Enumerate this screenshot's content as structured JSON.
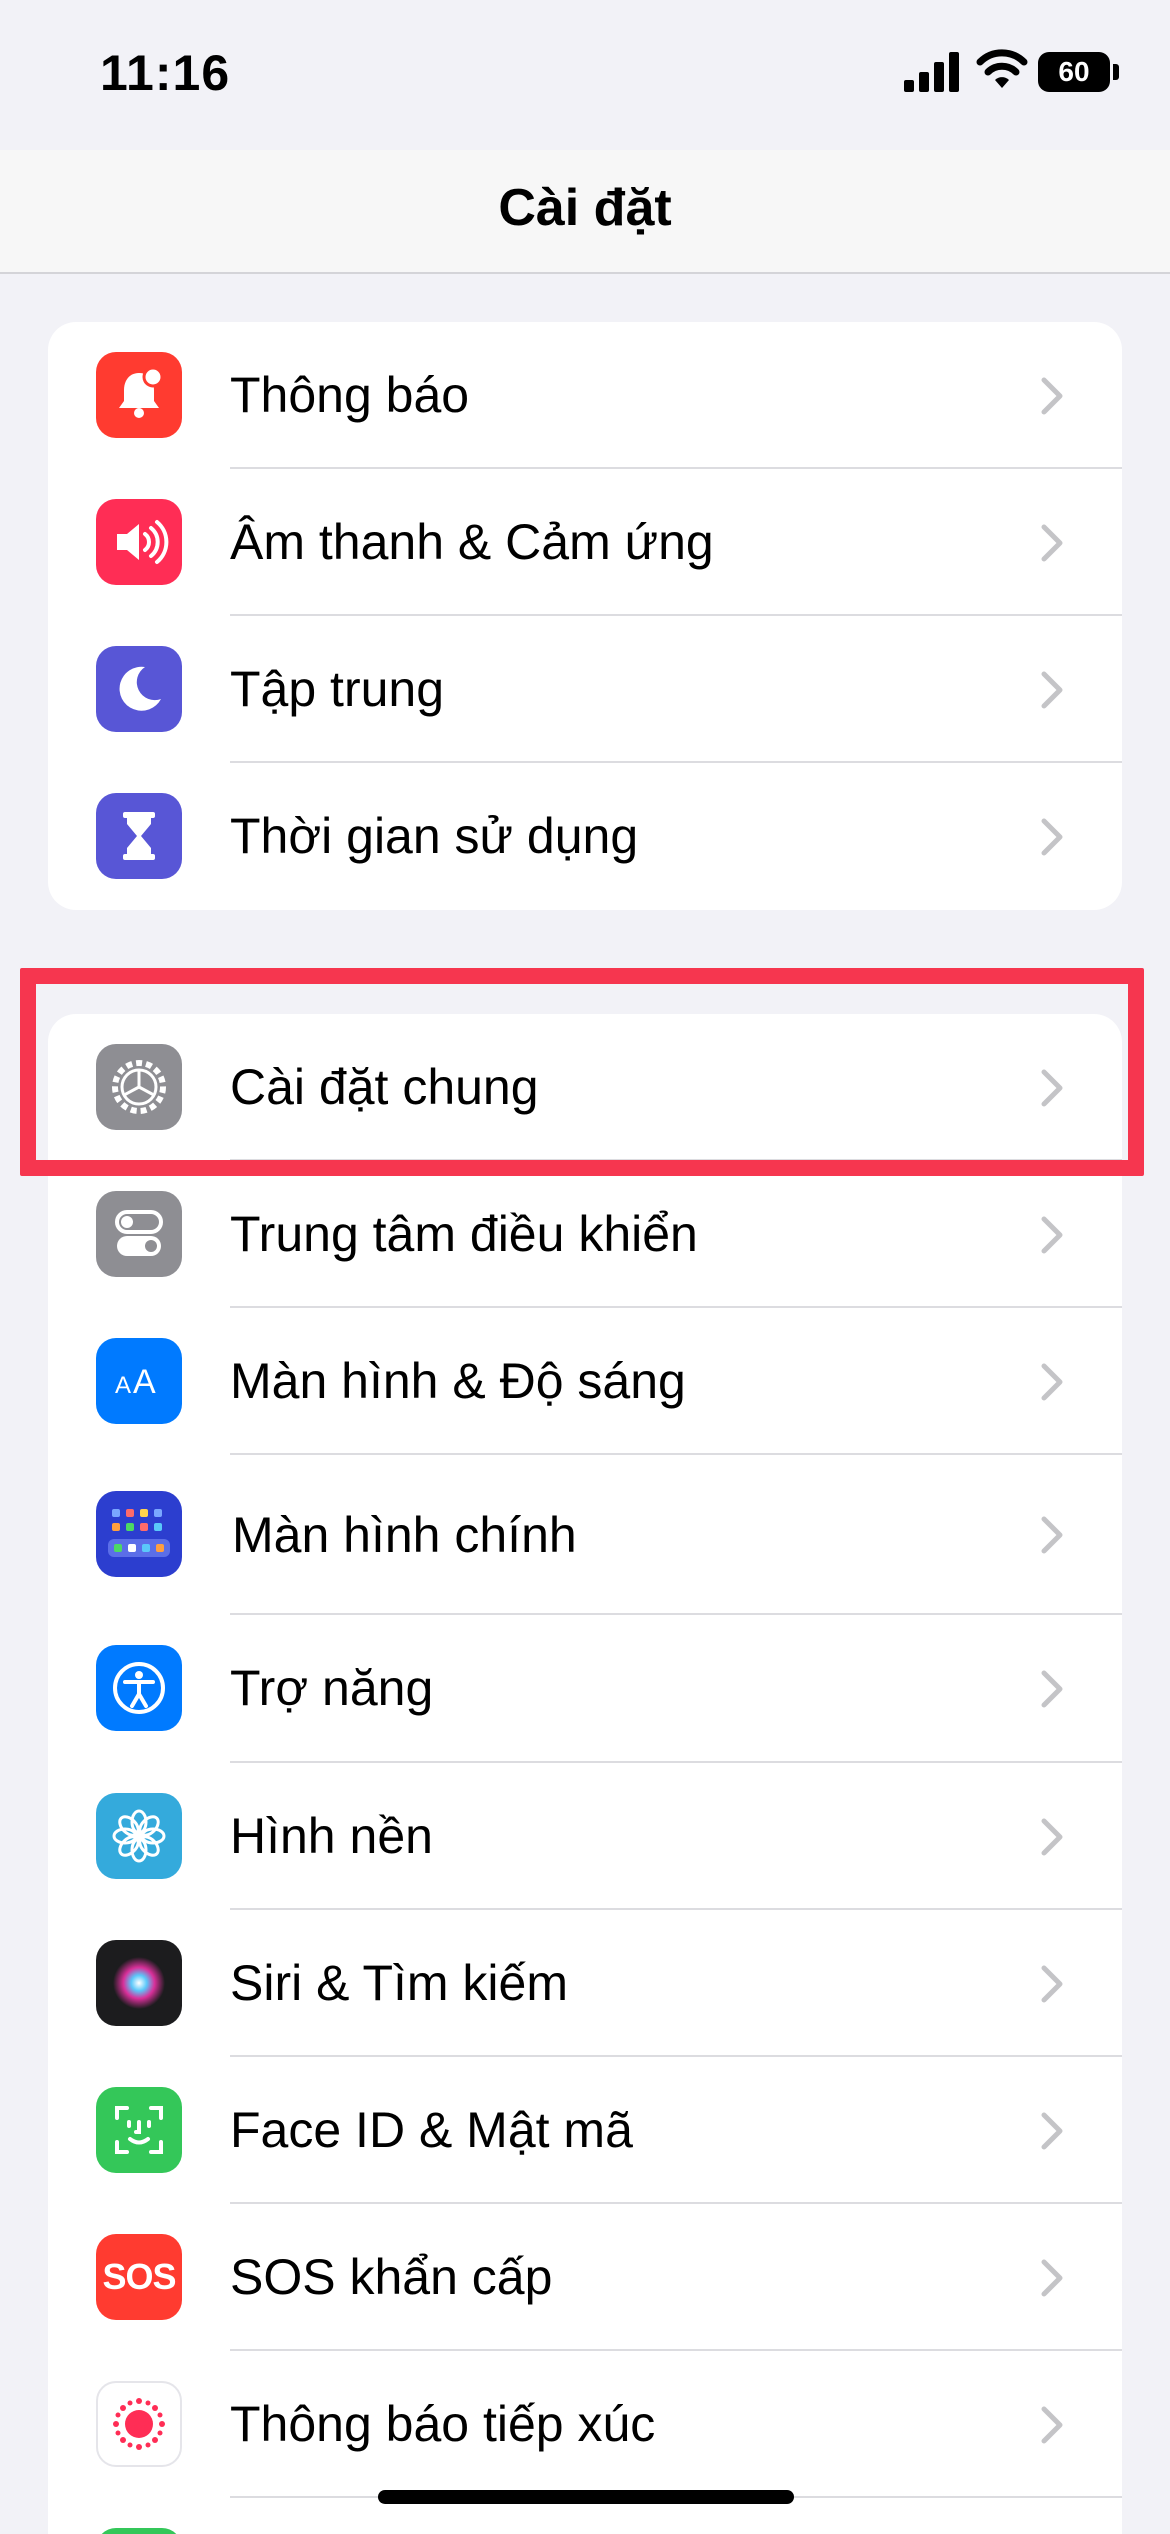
{
  "status": {
    "time": "11:16",
    "battery": "60"
  },
  "nav": {
    "title": "Cài đặt"
  },
  "groups": [
    {
      "items": [
        {
          "label": "Thông báo",
          "icon": "notifications-icon",
          "color": "#ff3b30"
        },
        {
          "label": "Âm thanh & Cảm ứng",
          "icon": "sounds-icon",
          "color": "#ff2d55"
        },
        {
          "label": "Tập trung",
          "icon": "focus-moon-icon",
          "color": "#5856d6"
        },
        {
          "label": "Thời gian sử dụng",
          "icon": "hourglass-icon",
          "color": "#5856d6"
        }
      ]
    },
    {
      "items": [
        {
          "label": "Cài đặt chung",
          "icon": "gear-icon",
          "color": "#8e8e93"
        },
        {
          "label": "Trung tâm điều khiển",
          "icon": "control-center-icon",
          "color": "#8e8e93"
        },
        {
          "label": "Màn hình & Độ sáng",
          "icon": "display-brightness-icon",
          "color": "#007aff"
        },
        {
          "label": "Màn hình chính",
          "icon": "home-screen-icon",
          "color": "#2c3ecf"
        },
        {
          "label": "Trợ năng",
          "icon": "accessibility-icon",
          "color": "#007aff"
        },
        {
          "label": "Hình nền",
          "icon": "wallpaper-flower-icon",
          "color": "#34aadc"
        },
        {
          "label": "Siri & Tìm kiếm",
          "icon": "siri-icon",
          "color": "#1c1c1e"
        },
        {
          "label": "Face ID & Mật mã",
          "icon": "face-id-icon",
          "color": "#34c759"
        },
        {
          "label": "SOS khẩn cấp",
          "icon": "sos-icon",
          "color": "#ff3b30",
          "icon_text": "SOS"
        },
        {
          "label": "Thông báo tiếp xúc",
          "icon": "exposure-notifications-icon",
          "color": "#ffffff"
        }
      ]
    }
  ],
  "highlight_color": "#f6364f"
}
